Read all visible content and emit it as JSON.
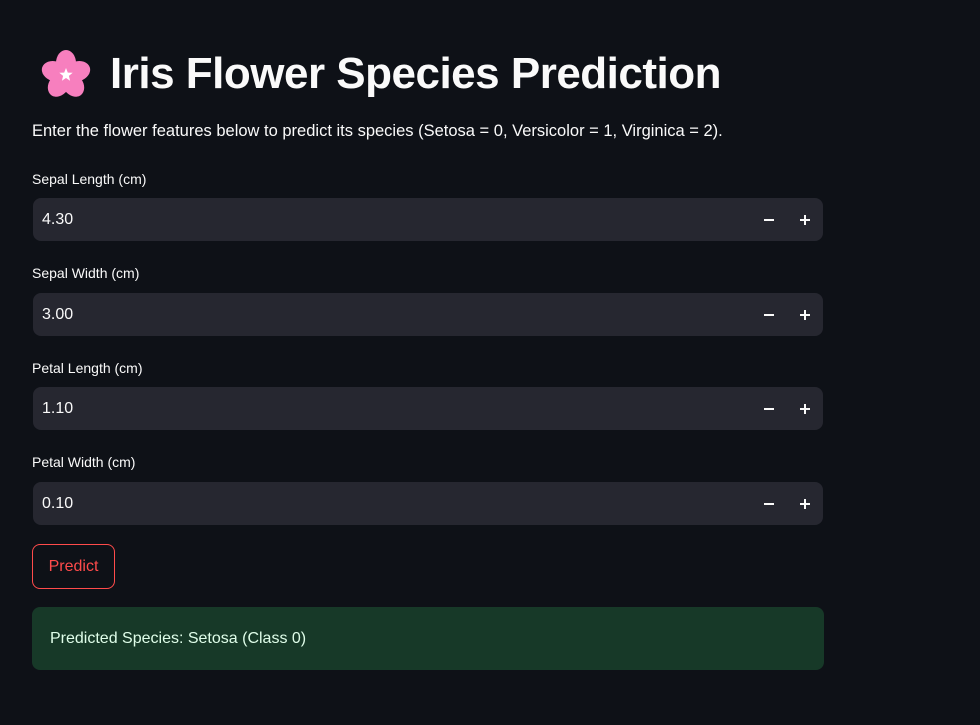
{
  "header": {
    "icon": "cherry-blossom-icon",
    "title": "Iris Flower Species Prediction",
    "subtitle": "Enter the flower features below to predict its species (Setosa = 0, Versicolor = 1, Virginica = 2)."
  },
  "fields": [
    {
      "label": "Sepal Length (cm)",
      "value": "4.30"
    },
    {
      "label": "Sepal Width (cm)",
      "value": "3.00"
    },
    {
      "label": "Petal Length (cm)",
      "value": "1.10"
    },
    {
      "label": "Petal Width (cm)",
      "value": "0.10"
    }
  ],
  "predict_button": {
    "label": "Predict"
  },
  "result": {
    "text": "Predicted Species: Setosa (Class 0)"
  },
  "colors": {
    "background": "#0e1117",
    "input_bg": "#262730",
    "accent": "#ff4b4b",
    "success_bg": "#173928",
    "success_text": "#dffde9",
    "blossom": "#f77fbe"
  }
}
